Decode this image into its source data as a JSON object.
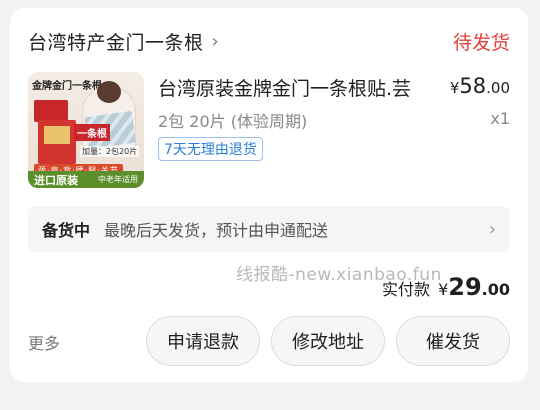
{
  "shop": {
    "name": "台湾特产金门一条根",
    "chevron": "›"
  },
  "order_status": "待发货",
  "product": {
    "title": "台湾原装金牌金门一条根贴.芸",
    "price": {
      "currency": "¥",
      "integer": "58",
      "decimal": ".00"
    },
    "spec": "2包 20片 (体验周期)",
    "quantity": "x1",
    "badge": "7天无理由退货",
    "image": {
      "brand_text": "金牌金门一条根",
      "tag": "一条根",
      "tag_sub": "加量：2包20片",
      "body_parts": "颈·肩·背·腰·腿·关节",
      "footer_left": "进口原装",
      "footer_right": "中老年适用"
    }
  },
  "shipping": {
    "status": "备货中",
    "description": "最晚后天发货，预计由申通配送",
    "chevron": "›"
  },
  "watermark": "线报酷-new.xianbao.fun",
  "payment": {
    "label": "实付款",
    "currency": "¥",
    "integer": "29",
    "decimal": ".00"
  },
  "actions": {
    "more": "更多",
    "refund": "申请退款",
    "change_address": "修改地址",
    "urge_shipment": "催发货"
  },
  "colors": {
    "status_red": "#e5403a",
    "badge_blue": "#2b7fd6"
  }
}
